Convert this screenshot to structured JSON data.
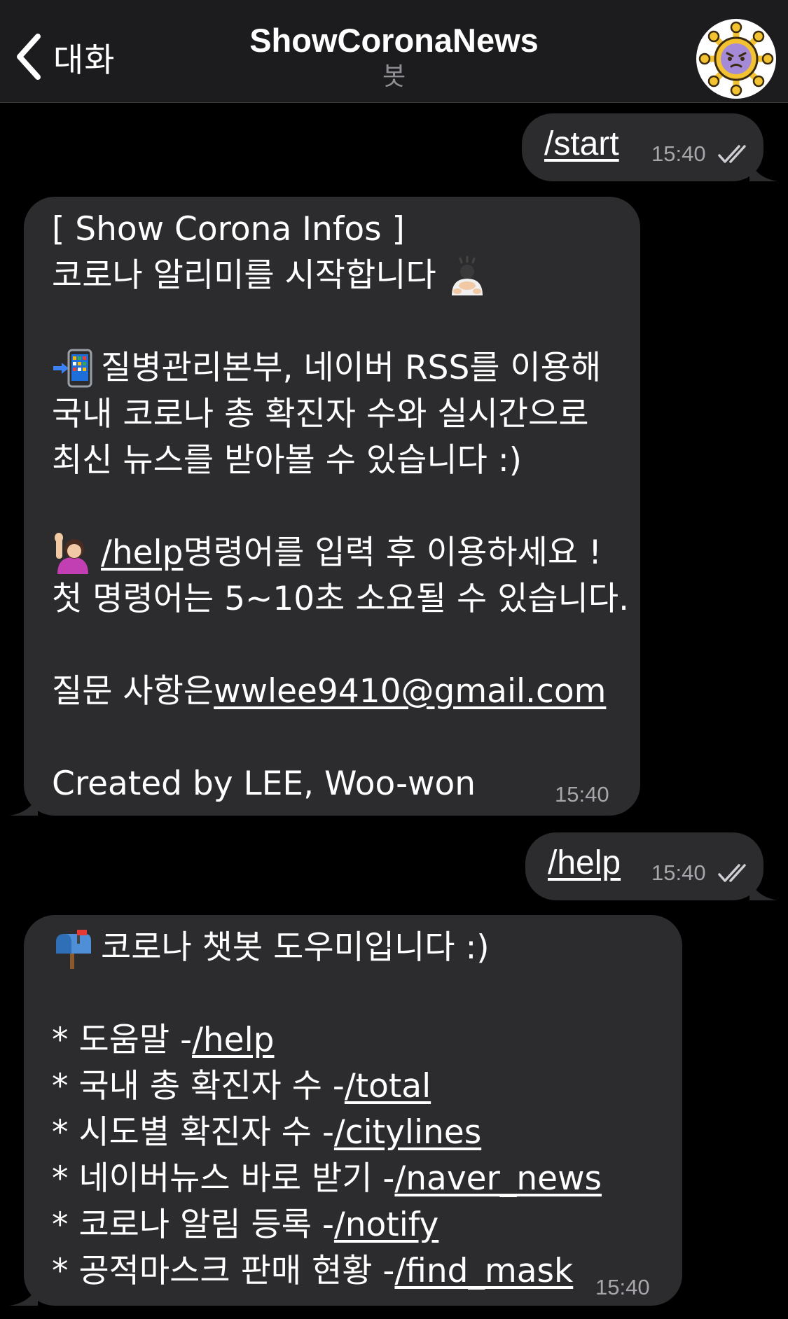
{
  "header": {
    "back_label": "대화",
    "title": "ShowCoronaNews",
    "subtitle": "봇"
  },
  "messages": {
    "m1": {
      "text": "/start",
      "time": "15:40"
    },
    "m2": {
      "lines": {
        "l1": "[ Show Corona Infos ]",
        "l2": "코로나 알리미를 시작합니다",
        "l3": "질병관리본부, 네이버 RSS를 이용해",
        "l4": "국내 코로나 총 확진자 수와 실시간으로",
        "l5": "최신 뉴스를 받아볼 수 있습니다 :)",
        "l6_link": "/help",
        "l6_rest": " 명령어를 입력 후 이용하세요 !",
        "l7": "첫 명령어는 5~10초 소요될 수 있습니다.",
        "l8_pre": "질문 사항은 ",
        "l8_link": "wwlee9410@gmail.com",
        "l9": "Created by LEE, Woo-won"
      },
      "time": "15:40"
    },
    "m3": {
      "text": "/help",
      "time": "15:40"
    },
    "m4": {
      "intro": "코로나 챗봇 도우미입니다 :)",
      "items": [
        {
          "label": "* 도움말 - ",
          "cmd": "/help"
        },
        {
          "label": "* 국내 총 확진자 수 - ",
          "cmd": "/total"
        },
        {
          "label": "* 시도별 확진자 수 - ",
          "cmd": "/citylines"
        },
        {
          "label": "* 네이버뉴스 바로 받기 - ",
          "cmd": "/naver_news"
        },
        {
          "label": "* 코로나 알림 등록 - ",
          "cmd": "/notify"
        },
        {
          "label": "* 공적마스크 판매 현황 - ",
          "cmd": "/find_mask"
        }
      ],
      "time": "15:40"
    }
  },
  "colors": {
    "background": "#000000",
    "header": "#1c1c1e",
    "bubble": "#2c2c2e",
    "time_text": "#a7a7ab",
    "subtitle": "#8e8e93"
  },
  "icons": [
    "chevron-left-icon",
    "virus-avatar-icon",
    "double-check-icon",
    "person-bowing-emoji",
    "mobile-arrow-emoji",
    "person-raising-hand-emoji",
    "mailbox-emoji"
  ]
}
